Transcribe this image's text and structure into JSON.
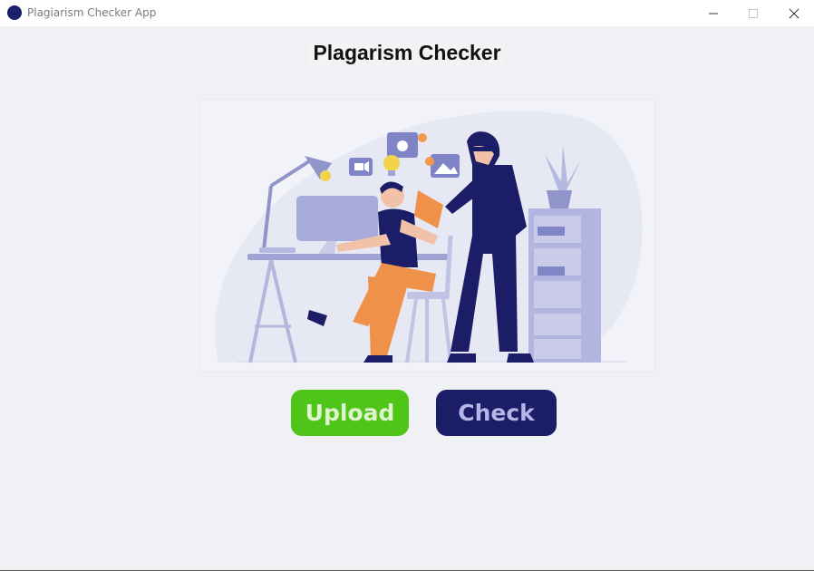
{
  "window": {
    "title": "Plagiarism Checker App",
    "icon": "app-circle-icon",
    "controls": [
      "minimize-icon",
      "maximize-icon",
      "close-icon"
    ]
  },
  "main": {
    "heading": "Plagarism Checker",
    "illustration": {
      "icon": "plagiarism-illustration"
    },
    "buttons": {
      "upload_label": "Upload",
      "check_label": "Check"
    }
  },
  "colors": {
    "background": "#f0f1f5",
    "upload": "#4fc419",
    "check": "#1b1e66",
    "accent_navy": "#1b1e66"
  }
}
